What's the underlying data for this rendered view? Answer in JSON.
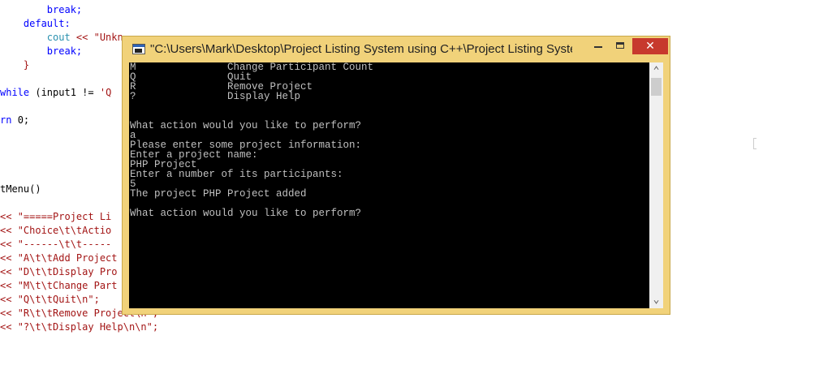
{
  "editor": {
    "lines": [
      [
        {
          "t": "        break;",
          "c": "c-kw"
        }
      ],
      [
        {
          "t": "    default:",
          "c": "c-kw"
        }
      ],
      [
        {
          "t": "        cout ",
          "c": "c-teal"
        },
        {
          "t": "<< ",
          "c": "c-op"
        },
        {
          "t": "\"Unkn",
          "c": "c-str"
        }
      ],
      [
        {
          "t": "        break;",
          "c": "c-kw"
        }
      ],
      [
        {
          "t": "    }",
          "c": "c-op"
        }
      ],
      [
        {
          "t": "",
          "c": "c-black"
        }
      ],
      [
        {
          "t": "while ",
          "c": "c-kw"
        },
        {
          "t": "(input1 != ",
          "c": "c-black"
        },
        {
          "t": "'Q",
          "c": "c-str"
        }
      ],
      [
        {
          "t": "",
          "c": "c-black"
        }
      ],
      [
        {
          "t": "rn ",
          "c": "c-kw"
        },
        {
          "t": "0;",
          "c": "c-num"
        }
      ],
      [
        {
          "t": "",
          "c": "c-black"
        }
      ],
      [
        {
          "t": "",
          "c": "c-black"
        }
      ],
      [
        {
          "t": "",
          "c": "c-black"
        }
      ],
      [
        {
          "t": "",
          "c": "c-black"
        }
      ],
      [
        {
          "t": "tMenu()",
          "c": "c-black"
        }
      ],
      [
        {
          "t": "",
          "c": "c-black"
        }
      ],
      [
        {
          "t": "<< ",
          "c": "c-op"
        },
        {
          "t": "\"=====Project Li",
          "c": "c-str"
        }
      ],
      [
        {
          "t": "<< ",
          "c": "c-op"
        },
        {
          "t": "\"Choice\\t\\tActio",
          "c": "c-str"
        }
      ],
      [
        {
          "t": "<< ",
          "c": "c-op"
        },
        {
          "t": "\"------\\t\\t-----",
          "c": "c-str"
        }
      ],
      [
        {
          "t": "<< ",
          "c": "c-op"
        },
        {
          "t": "\"A\\t\\tAdd Project",
          "c": "c-str"
        }
      ],
      [
        {
          "t": "<< ",
          "c": "c-op"
        },
        {
          "t": "\"D\\t\\tDisplay Pro",
          "c": "c-str"
        }
      ],
      [
        {
          "t": "<< ",
          "c": "c-op"
        },
        {
          "t": "\"M\\t\\tChange Part",
          "c": "c-str"
        }
      ],
      [
        {
          "t": "<< ",
          "c": "c-op"
        },
        {
          "t": "\"Q\\t\\tQuit\\n\";",
          "c": "c-str"
        }
      ],
      [
        {
          "t": "<< ",
          "c": "c-op"
        },
        {
          "t": "\"R\\t\\tRemove Project\\n\";",
          "c": "c-str"
        }
      ],
      [
        {
          "t": "<< ",
          "c": "c-op"
        },
        {
          "t": "\"?\\t\\tDisplay Help\\n\\n\";",
          "c": "c-str"
        }
      ]
    ]
  },
  "console": {
    "title": "\"C:\\Users\\Mark\\Desktop\\Project Listing System using C++\\Project Listing Syste...",
    "lines": [
      "M               Change Participant Count",
      "Q               Quit",
      "R               Remove Project",
      "?               Display Help",
      "",
      "",
      "What action would you like to perform?",
      "a",
      "Please enter some project information:",
      "Enter a project name:",
      "PHP Project",
      "Enter a number of its participants:",
      "5",
      "The project PHP Project added",
      "",
      "What action would you like to perform?"
    ]
  },
  "icons": {
    "app": "console-app-icon",
    "minimize": "minimize-icon",
    "maximize": "maximize-icon",
    "close": "close-icon",
    "scroll_up": "chevron-up-icon",
    "scroll_down": "chevron-down-icon"
  },
  "colors": {
    "window_frame": "#f1d27a",
    "close_button": "#c7392d",
    "console_bg": "#000000",
    "console_text": "#c0c0c0"
  }
}
